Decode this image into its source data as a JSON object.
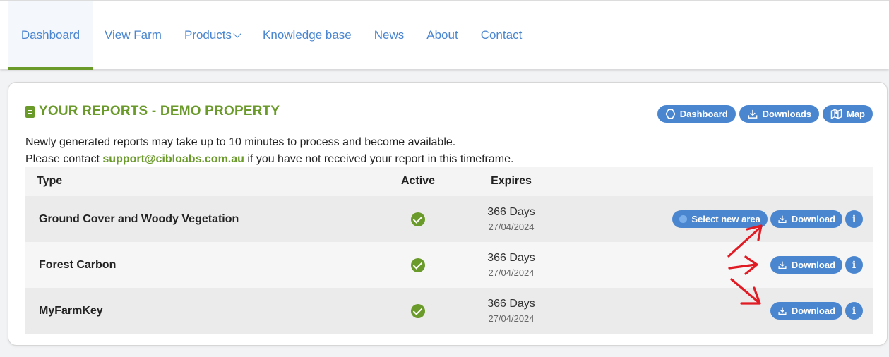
{
  "nav": {
    "items": [
      {
        "label": "Dashboard"
      },
      {
        "label": "View Farm"
      },
      {
        "label": "Products"
      },
      {
        "label": "Knowledge base"
      },
      {
        "label": "News"
      },
      {
        "label": "About"
      },
      {
        "label": "Contact"
      }
    ]
  },
  "card": {
    "title": "YOUR REPORTS - DEMO PROPERTY",
    "buttons": {
      "dashboard": "Dashboard",
      "downloads": "Downloads",
      "map": "Map"
    },
    "notice_line1": "Newly generated reports may take up to 10 minutes to process and become available.",
    "notice_line2_pre": "Please contact ",
    "notice_email": "support@cibloabs.com.au",
    "notice_line2_post": " if you have not received your report in this timeframe."
  },
  "table": {
    "headers": {
      "type": "Type",
      "active": "Active",
      "expires": "Expires"
    },
    "rows": [
      {
        "type": "Ground Cover and Woody Vegetation",
        "days": "366 Days",
        "date": "27/04/2024",
        "select_label": "Select new area",
        "download_label": "Download"
      },
      {
        "type": "Forest Carbon",
        "days": "366 Days",
        "date": "27/04/2024",
        "download_label": "Download"
      },
      {
        "type": "MyFarmKey",
        "days": "366 Days",
        "date": "27/04/2024",
        "download_label": "Download"
      }
    ]
  },
  "colors": {
    "accent_green": "#6a9a2a",
    "accent_blue": "#4a86d0",
    "annotation_red": "#e01b24"
  },
  "icons": [
    "document-icon",
    "hexagon-icon",
    "download-icon",
    "map-icon",
    "check-icon",
    "info-icon",
    "red-arrow"
  ]
}
